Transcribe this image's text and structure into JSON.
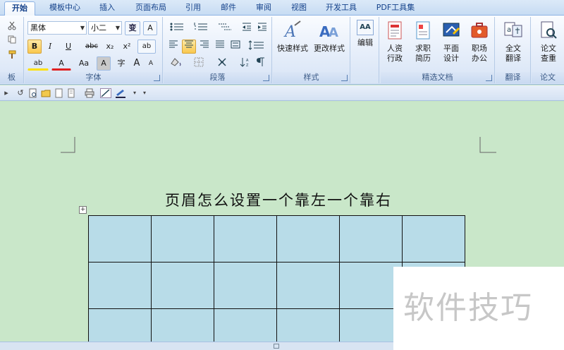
{
  "tabs": [
    "开始",
    "模板中心",
    "插入",
    "页面布局",
    "引用",
    "邮件",
    "审阅",
    "视图",
    "开发工具",
    "PDF工具集"
  ],
  "ribbon": {
    "font": {
      "name": "黑体",
      "size": "小二",
      "phonetic_label": "变",
      "border_label": "A",
      "bold": "B",
      "italic": "I",
      "underline": "U",
      "strike": "abc",
      "subscript": "x₂",
      "superscript": "x²",
      "clear": "ab",
      "highlight": "ab",
      "color": "A",
      "case": "Aa",
      "shade": "A",
      "enclose": "字",
      "grow": "A",
      "shrink": "A",
      "label": "字体"
    },
    "paragraph": {
      "label": "段落"
    },
    "styles": {
      "quick_label": "快速样式",
      "change_label": "更改样式",
      "label": "样式"
    },
    "editing": {
      "label": "编辑",
      "icon_text": "AA"
    },
    "templates": {
      "items": [
        {
          "line1": "人资",
          "line2": "行政"
        },
        {
          "line1": "求职",
          "line2": "简历"
        },
        {
          "line1": "平面",
          "line2": "设计"
        },
        {
          "line1": "职场",
          "line2": "办公"
        }
      ],
      "label": "精选文档"
    },
    "translate": {
      "line1": "全文",
      "line2": "翻译",
      "label": "翻译"
    },
    "paper": {
      "line1": "论文",
      "line2": "查重",
      "label": "论文"
    },
    "clipboard_label": "板"
  },
  "document": {
    "title": "页眉怎么设置一个靠左一个靠右",
    "table": {
      "rows": 3,
      "cols": 6
    },
    "move_handle": "+"
  },
  "watermark": "软件技巧",
  "colors": {
    "page_bg": "#c9e7c9",
    "cell_bg": "#b8dce8",
    "ribbon_accent": "#15428b"
  }
}
